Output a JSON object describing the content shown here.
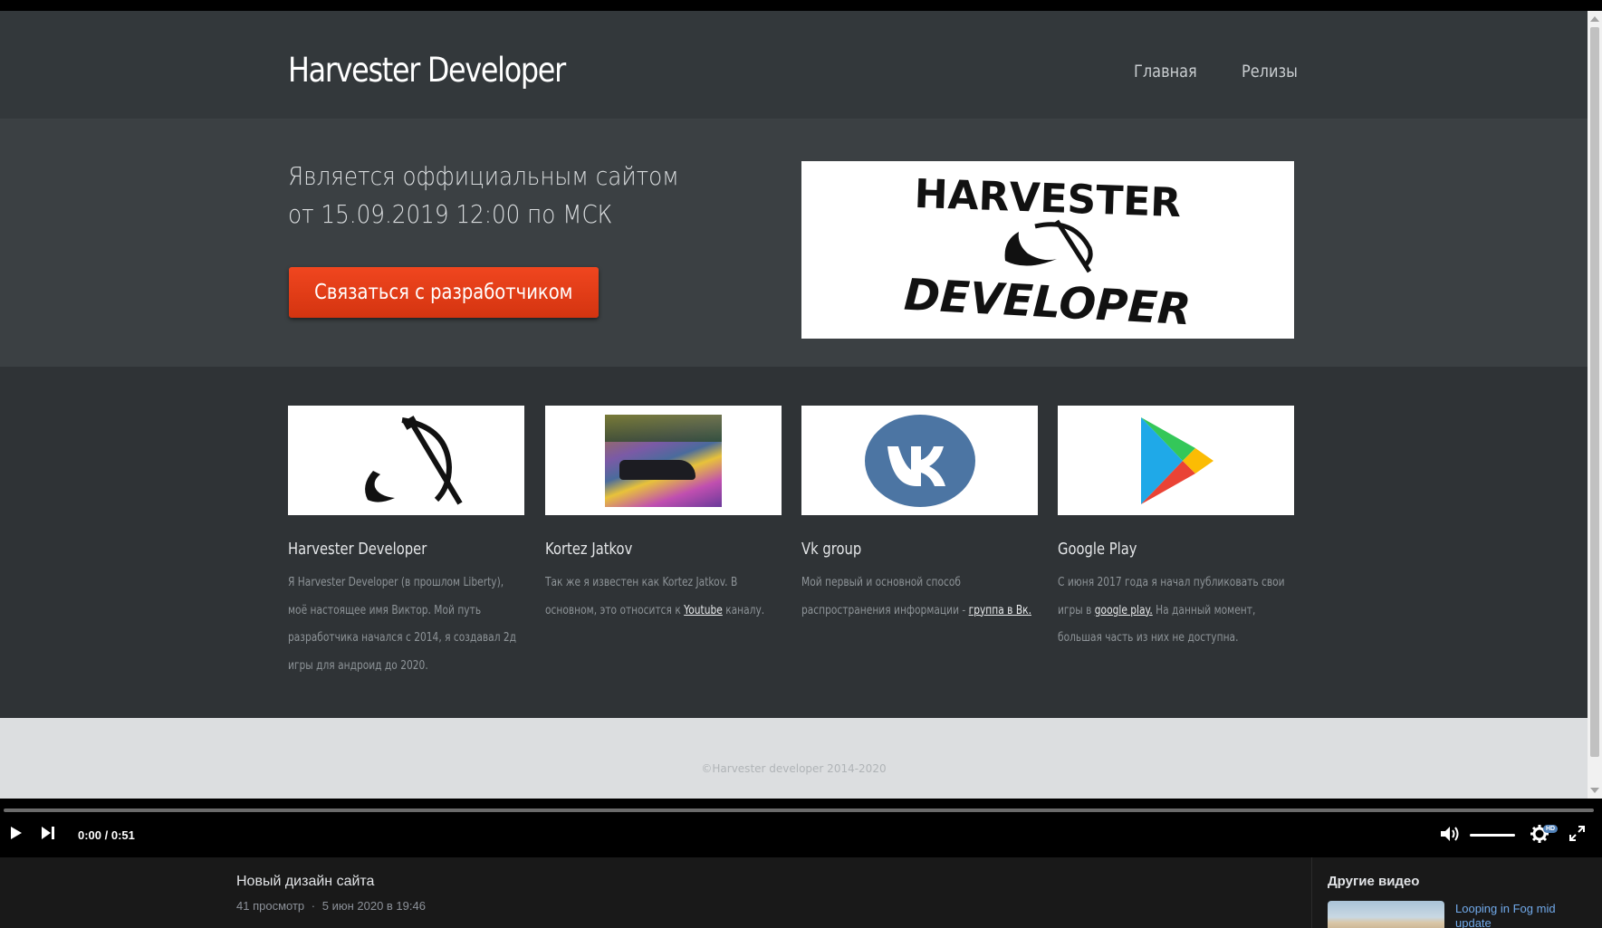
{
  "site": {
    "logo_text": "Harvester Developer",
    "nav": {
      "home": "Главная",
      "releases": "Релизы"
    },
    "hero": {
      "text": "Является оффициальным сайтом от 15.09.2019 12:00 по МСК",
      "button": "Связаться с разработчиком",
      "logo_line1": "HARVESTER",
      "logo_line2": "DEVELOPER"
    },
    "cards": [
      {
        "title": "Harvester Developer",
        "desc": "Я Harvester Developer (в прошлом Liberty), моё настоящее имя Виктор. Мой путь разработчика начался с 2014, я создавал 2д игры для андроид до 2020."
      },
      {
        "title": "Kortez Jatkov",
        "desc_pre": "Так же я известен как Kortez Jatkov. В основном, это относится к ",
        "link": "Youtube",
        "desc_post": " каналу."
      },
      {
        "title": "Vk group",
        "desc_pre": "Мой первый и основной способ распространения информации - ",
        "link": "группа в Вк."
      },
      {
        "title": "Google Play",
        "desc_pre": "С июня 2017 года я начал публиковать свои игры в ",
        "link": "google play.",
        "desc_post": " На данный момент, большая часть из них не доступна."
      }
    ],
    "footer": "©Harvester developer 2014-2020"
  },
  "player": {
    "current_time": "0:00",
    "separator": " / ",
    "duration": "0:51",
    "progress": 0,
    "volume": 1.0,
    "hd_badge": "HD"
  },
  "video": {
    "title": "Новый дизайн сайта",
    "views": "41 просмотр",
    "dot": "·",
    "date": "5 июн 2020 в 19:46"
  },
  "sidebar": {
    "title": "Другие видео",
    "items": [
      {
        "title": "Looping in Fog mid update"
      }
    ]
  },
  "colors": {
    "accent_button": "#e33d15",
    "link_blue": "#71aaeb",
    "vk_blue": "#4c75a3"
  }
}
